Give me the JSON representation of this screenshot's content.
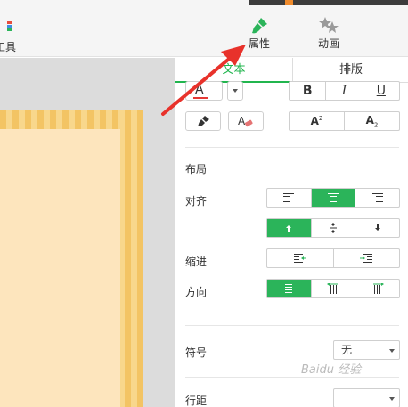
{
  "toolbar": {
    "tools_label": "工具",
    "properties_label": "属性",
    "animation_label": "动画"
  },
  "panel": {
    "tabs": [
      "文本",
      "排版"
    ],
    "layout_heading": "布局",
    "align_label": "对齐",
    "indent_label": "缩进",
    "direction_label": "方向",
    "symbol_label": "符号",
    "symbol_value": "无",
    "line_spacing_label": "行距"
  },
  "format": {
    "font_color_glyph": "A",
    "bold": "B",
    "italic": "I",
    "underline": "U",
    "superscript_letter": "A",
    "superscript_mark": "2",
    "subscript_letter": "A",
    "subscript_mark": "2"
  },
  "watermark": "Baidu 经验",
  "colors": {
    "accent": "#2bb45a",
    "arrow": "#e8322b",
    "font_color_underline": "#e53935"
  }
}
